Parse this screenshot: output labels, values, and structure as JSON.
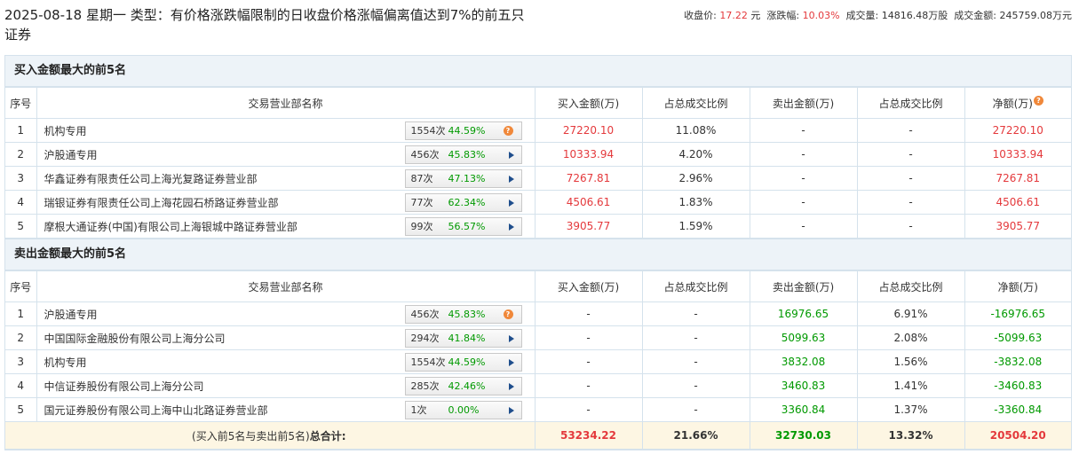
{
  "header": {
    "title": "2025-08-18 星期一 类型：有价格涨跌幅限制的日收盘价格涨幅偏离值达到7%的前五只证券",
    "close_label": "收盘价:",
    "close_value": "17.22",
    "close_unit": "元",
    "change_label": "涨跌幅:",
    "change_value": "10.03%",
    "volume_label": "成交量:",
    "volume_value": "14816.48万股",
    "amount_label": "成交金额:",
    "amount_value": "245759.08万元"
  },
  "buy_section": {
    "title": "买入金额最大的前5名",
    "columns": [
      "序号",
      "交易营业部名称",
      "买入金额(万)",
      "占总成交比例",
      "卖出金额(万)",
      "占总成交比例",
      "净额(万)"
    ],
    "rows": [
      {
        "idx": "1",
        "name": "机构专用",
        "count": "1554次",
        "rate": "44.59%",
        "icon": "help-icon",
        "buy": "27220.10",
        "buy_pct": "11.08%",
        "sell": "-",
        "sell_pct": "-",
        "net": "27220.10"
      },
      {
        "idx": "2",
        "name": "沪股通专用",
        "count": "456次",
        "rate": "45.83%",
        "icon": "arrow-right-icon",
        "buy": "10333.94",
        "buy_pct": "4.20%",
        "sell": "-",
        "sell_pct": "-",
        "net": "10333.94"
      },
      {
        "idx": "3",
        "name": "华鑫证券有限责任公司上海光复路证券营业部",
        "count": "87次",
        "rate": "47.13%",
        "icon": "arrow-right-icon",
        "buy": "7267.81",
        "buy_pct": "2.96%",
        "sell": "-",
        "sell_pct": "-",
        "net": "7267.81"
      },
      {
        "idx": "4",
        "name": "瑞银证券有限责任公司上海花园石桥路证券营业部",
        "count": "77次",
        "rate": "62.34%",
        "icon": "arrow-right-icon",
        "buy": "4506.61",
        "buy_pct": "1.83%",
        "sell": "-",
        "sell_pct": "-",
        "net": "4506.61"
      },
      {
        "idx": "5",
        "name": "摩根大通证券(中国)有限公司上海银城中路证券营业部",
        "count": "99次",
        "rate": "56.57%",
        "icon": "arrow-right-icon",
        "buy": "3905.77",
        "buy_pct": "1.59%",
        "sell": "-",
        "sell_pct": "-",
        "net": "3905.77"
      }
    ]
  },
  "sell_section": {
    "title": "卖出金额最大的前5名",
    "columns": [
      "序号",
      "交易营业部名称",
      "买入金额(万)",
      "占总成交比例",
      "卖出金额(万)",
      "占总成交比例",
      "净额(万)"
    ],
    "rows": [
      {
        "idx": "1",
        "name": "沪股通专用",
        "count": "456次",
        "rate": "45.83%",
        "icon": "help-icon",
        "buy": "-",
        "buy_pct": "-",
        "sell": "16976.65",
        "sell_pct": "6.91%",
        "net": "-16976.65"
      },
      {
        "idx": "2",
        "name": "中国国际金融股份有限公司上海分公司",
        "count": "294次",
        "rate": "41.84%",
        "icon": "arrow-right-icon",
        "buy": "-",
        "buy_pct": "-",
        "sell": "5099.63",
        "sell_pct": "2.08%",
        "net": "-5099.63"
      },
      {
        "idx": "3",
        "name": "机构专用",
        "count": "1554次",
        "rate": "44.59%",
        "icon": "arrow-right-icon",
        "buy": "-",
        "buy_pct": "-",
        "sell": "3832.08",
        "sell_pct": "1.56%",
        "net": "-3832.08"
      },
      {
        "idx": "4",
        "name": "中信证券股份有限公司上海分公司",
        "count": "285次",
        "rate": "42.46%",
        "icon": "arrow-right-icon",
        "buy": "-",
        "buy_pct": "-",
        "sell": "3460.83",
        "sell_pct": "1.41%",
        "net": "-3460.83"
      },
      {
        "idx": "5",
        "name": "国元证券股份有限公司上海中山北路证券营业部",
        "count": "1次",
        "rate": "0.00%",
        "icon": "arrow-right-icon",
        "buy": "-",
        "buy_pct": "-",
        "sell": "3360.84",
        "sell_pct": "1.37%",
        "net": "-3360.84"
      }
    ]
  },
  "totals": {
    "label_prefix": "(买入前5名与卖出前5名)",
    "label_bold": "总合计:",
    "buy": "53234.22",
    "buy_pct": "21.66%",
    "sell": "32730.03",
    "sell_pct": "13.32%",
    "net": "20504.20"
  },
  "colors": {
    "up": "#e4393c",
    "down": "#009900",
    "header_bg": "#edf3f8",
    "total_bg": "#fdf6e3"
  }
}
